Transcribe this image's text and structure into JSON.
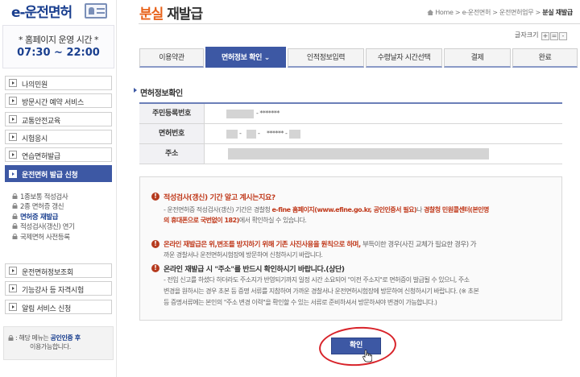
{
  "sidebar": {
    "logo": "e-운전면허",
    "hours_title": "* 홈페이지 운영 시간 *",
    "hours_time": "07:30 ~ 22:00",
    "menu": [
      {
        "label": "나의민원"
      },
      {
        "label": "방문시간 예약 서비스"
      },
      {
        "label": "교통안전교육"
      },
      {
        "label": "시험응시"
      },
      {
        "label": "연습면허발급"
      },
      {
        "label": "운전면허 발급 신청"
      }
    ],
    "submenu": [
      {
        "label": "1종보통 적성검사"
      },
      {
        "label": "2종 면허증 갱신"
      },
      {
        "label": "면허증 재발급"
      },
      {
        "label": "적성검사(갱신) 연기"
      },
      {
        "label": "국제면허 사전등록"
      }
    ],
    "menu2": [
      {
        "label": "운전면허정보조회"
      },
      {
        "label": "기능강사 등 자격시험"
      },
      {
        "label": "알림 서비스 신청"
      }
    ],
    "note": {
      "prefix": ": 해당 메뉴는 ",
      "bold": "공인인증 후",
      "line2": "이용가능합니다."
    }
  },
  "header": {
    "title_accent": "분실",
    "title_rest": " 재발급",
    "breadcrumb": {
      "home": "Home",
      "sep": ">",
      "items": [
        "e-운전면허",
        "운전면허업무",
        "분실 재발급"
      ]
    },
    "fontsize_label": "글자크기",
    "fontsize_plus": "+",
    "fontsize_equal": "=",
    "fontsize_minus": "-"
  },
  "steps": [
    {
      "label": "이용약관"
    },
    {
      "label": "면허정보 확인 ⌄"
    },
    {
      "label": "인적정보입력"
    },
    {
      "label": "수령날자 시간선택"
    },
    {
      "label": "결제"
    },
    {
      "label": "완료"
    }
  ],
  "section_title": "면허정보확인",
  "info": {
    "rows": [
      {
        "label": "주민등록번호",
        "value": "- *******"
      },
      {
        "label": "면허번호",
        "value_a": "-",
        "value_b": "-",
        "value_c": "****** -"
      },
      {
        "label": "주소"
      }
    ]
  },
  "notice": {
    "n1_head": "적성검사(갱신) 기간 알고 계시는지요?",
    "n1_l1_a": "- 운전면허증 적성검사(갱신) 기간은 경찰청 ",
    "n1_l1_b": "e-fine 홈페이지(www.efine.go.kr, 공인인증서 필요)",
    "n1_l1_c": "나 ",
    "n1_l1_d": "경찰청 민원콜센터(본인명",
    "n1_l2_a": "의 휴대폰으로 국번없이 182)",
    "n1_l2_b": "에서 확인하실 수 있습니다.",
    "n2_head": "온라인 재발급은 위,변조를 방지하기 위해 기존 사진사용을 원칙으로 하며,",
    "n2_tail": " 부득이한 경우(사진 교체가 필요한 경우) 가",
    "n2_l2": "까운 경찰서나 운전면허시험장에 방문하여 신청하시기 바랍니다.",
    "n3_head": "온라인 재발급 시 \"주소\"를 반드시 확인하시기 바랍니다.(상단)",
    "n3_l1": "- 전입 신고를 하셨다 하더라도 주소지가 반영되기까지 일정 시간 소요되어 \"이전 주소지\"로 면허증이 발급될 수 있으니, 주소",
    "n3_l2": "변경을 원하시는 경우 초본 등 증명 서류를 지참하여 가까운 경찰서나 운전면허시험장에 방문하여 신청하시기 바랍니다. (※ 초본",
    "n3_l3": "등 증명서류에는 본인의 \"주소 변경 이력\"을 확인할 수 있는 서류로 준비하셔서 방문하셔야 변경이 가능합니다.)"
  },
  "confirm_label": "확인",
  "colors": {
    "brand": "#3d58a4",
    "accent": "#e8621a",
    "warning": "#c0391b",
    "highlight_ring": "#d8232a"
  }
}
